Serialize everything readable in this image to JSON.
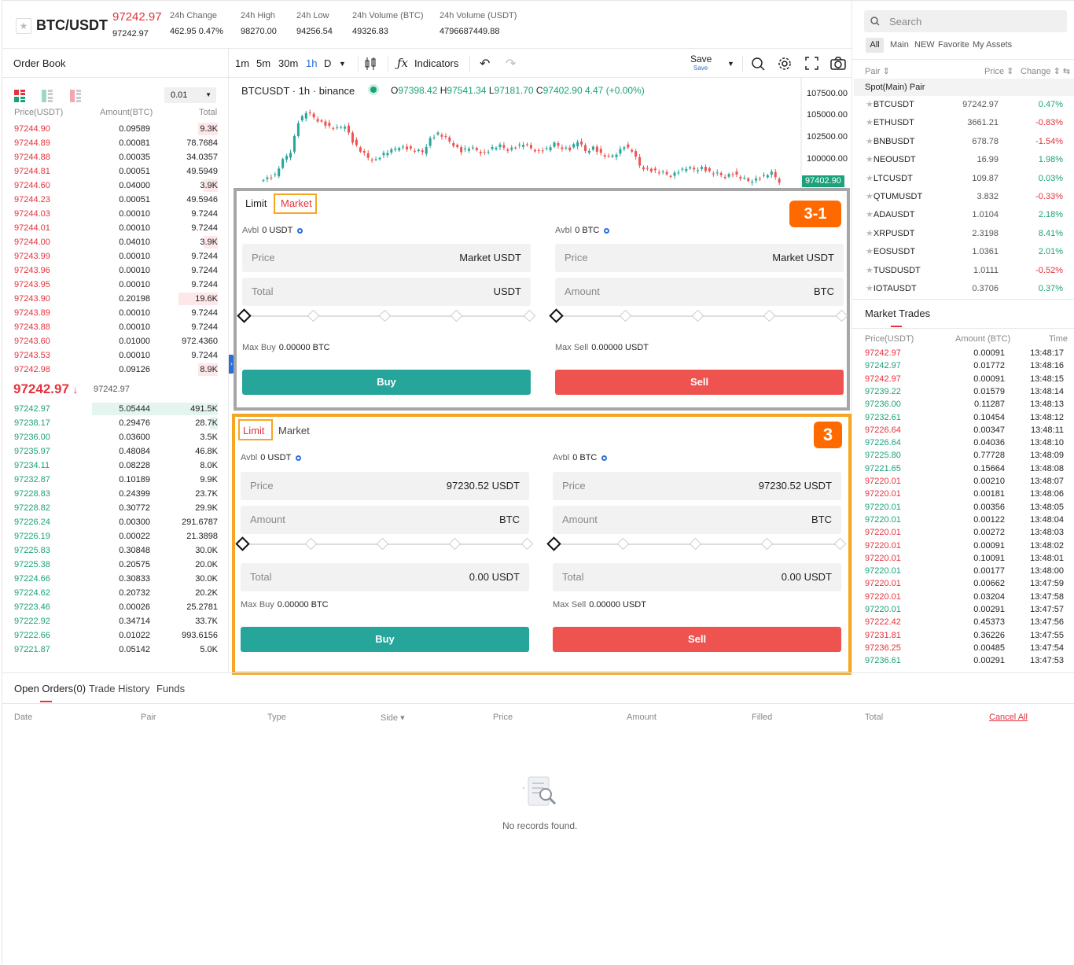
{
  "header": {
    "pair": "BTC/USDT",
    "last_price": "97242.97",
    "last_price_sub": "97242.97",
    "stats": [
      {
        "label": "24h Change",
        "value": "462.95 0.47%"
      },
      {
        "label": "24h High",
        "value": "98270.00"
      },
      {
        "label": "24h Low",
        "value": "94256.54"
      },
      {
        "label": "24h Volume (BTC)",
        "value": "49326.83"
      },
      {
        "label": "24h Volume (USDT)",
        "value": "4796687449.88"
      }
    ]
  },
  "order_book": {
    "title": "Order Book",
    "precision": "0.01",
    "cols": [
      "Price(USDT)",
      "Amount(BTC)",
      "Total"
    ],
    "asks": [
      [
        "97244.90",
        "0.09589",
        "9.3K"
      ],
      [
        "97244.89",
        "0.00081",
        "78.7684"
      ],
      [
        "97244.88",
        "0.00035",
        "34.0357"
      ],
      [
        "97244.81",
        "0.00051",
        "49.5949"
      ],
      [
        "97244.60",
        "0.04000",
        "3.9K"
      ],
      [
        "97244.23",
        "0.00051",
        "49.5946"
      ],
      [
        "97244.03",
        "0.00010",
        "9.7244"
      ],
      [
        "97244.01",
        "0.00010",
        "9.7244"
      ],
      [
        "97244.00",
        "0.04010",
        "3.9K"
      ],
      [
        "97243.99",
        "0.00010",
        "9.7244"
      ],
      [
        "97243.96",
        "0.00010",
        "9.7244"
      ],
      [
        "97243.95",
        "0.00010",
        "9.7244"
      ],
      [
        "97243.90",
        "0.20198",
        "19.6K"
      ],
      [
        "97243.89",
        "0.00010",
        "9.7244"
      ],
      [
        "97243.88",
        "0.00010",
        "9.7244"
      ],
      [
        "97243.60",
        "0.01000",
        "972.4360"
      ],
      [
        "97243.53",
        "0.00010",
        "9.7244"
      ],
      [
        "97242.98",
        "0.09126",
        "8.9K"
      ]
    ],
    "mid_price": "97242.97",
    "mid_arrow": "↓",
    "mid_sub": "97242.97",
    "bids": [
      [
        "97242.97",
        "5.05444",
        "491.5K"
      ],
      [
        "97238.17",
        "0.29476",
        "28.7K"
      ],
      [
        "97236.00",
        "0.03600",
        "3.5K"
      ],
      [
        "97235.97",
        "0.48084",
        "46.8K"
      ],
      [
        "97234.11",
        "0.08228",
        "8.0K"
      ],
      [
        "97232.87",
        "0.10189",
        "9.9K"
      ],
      [
        "97228.83",
        "0.24399",
        "23.7K"
      ],
      [
        "97228.82",
        "0.30772",
        "29.9K"
      ],
      [
        "97226.24",
        "0.00300",
        "291.6787"
      ],
      [
        "97226.19",
        "0.00022",
        "21.3898"
      ],
      [
        "97225.83",
        "0.30848",
        "30.0K"
      ],
      [
        "97225.38",
        "0.20575",
        "20.0K"
      ],
      [
        "97224.66",
        "0.30833",
        "30.0K"
      ],
      [
        "97224.62",
        "0.20732",
        "20.2K"
      ],
      [
        "97223.46",
        "0.00026",
        "25.2781"
      ],
      [
        "97222.92",
        "0.34714",
        "33.7K"
      ],
      [
        "97222.66",
        "0.01022",
        "993.6156"
      ],
      [
        "97221.87",
        "0.05142",
        "5.0K"
      ]
    ],
    "ask_depth": [
      0.05,
      0,
      0,
      0,
      0.02,
      0,
      0,
      0,
      0.02,
      0,
      0,
      0,
      0.1,
      0,
      0,
      0,
      0,
      0.05
    ],
    "bid_depth": [
      1.0,
      0.06,
      0,
      0,
      0,
      0,
      0,
      0,
      0,
      0,
      0,
      0,
      0,
      0,
      0,
      0,
      0,
      0
    ]
  },
  "chart_toolbar": {
    "intervals": [
      "1m",
      "5m",
      "30m",
      "1h",
      "D"
    ],
    "active": "1h",
    "indicators": "Indicators",
    "save": "Save",
    "save_sub": "Save"
  },
  "chart": {
    "symbol": "BTCUSDT · 1h · binance",
    "ohlc": {
      "o_label": "O",
      "o": "97398.42",
      "h_label": "H",
      "h": "97541.34",
      "l_label": "L",
      "l": "97181.70",
      "c_label": "C",
      "c": "97402.90",
      "chg": "4.47 (+0.00%)"
    },
    "y_ticks": [
      "107500.00",
      "105000.00",
      "102500.00",
      "100000.00"
    ],
    "current": "97402.90"
  },
  "market_form": {
    "tab_limit": "Limit",
    "tab_market": "Market",
    "badge": "3-1",
    "buy": {
      "avbl_label": "Avbl",
      "avbl": "0 USDT",
      "price_label": "Price",
      "price": "Market USDT",
      "total_label": "Total",
      "total": "USDT",
      "max_label": "Max Buy",
      "max": "0.00000  BTC",
      "button": "Buy"
    },
    "sell": {
      "avbl_label": "Avbl",
      "avbl": "0 BTC",
      "price_label": "Price",
      "price": "Market USDT",
      "amount_label": "Amount",
      "amount": "BTC",
      "max_label": "Max Sell",
      "max": "0.00000  USDT",
      "button": "Sell"
    }
  },
  "limit_form": {
    "tab_limit": "Limit",
    "tab_market": "Market",
    "badge": "3",
    "buy": {
      "avbl_label": "Avbl",
      "avbl": "0 USDT",
      "price_label": "Price",
      "price": "97230.52 USDT",
      "amount_label": "Amount",
      "amount": "BTC",
      "total_label": "Total",
      "total": "0.00 USDT",
      "max_label": "Max Buy",
      "max": "0.00000  BTC",
      "button": "Buy"
    },
    "sell": {
      "avbl_label": "Avbl",
      "avbl": "0 BTC",
      "price_label": "Price",
      "price": "97230.52 USDT",
      "amount_label": "Amount",
      "amount": "BTC",
      "total_label": "Total",
      "total": "0.00 USDT",
      "max_label": "Max Sell",
      "max": "0.00000  USDT",
      "button": "Sell"
    }
  },
  "orders": {
    "tabs": [
      "Open Orders(0)",
      "Trade History",
      "Funds"
    ],
    "cols": [
      "Date",
      "Pair",
      "Type",
      "Side ▾",
      "Price",
      "Amount",
      "Filled",
      "Total"
    ],
    "cancel_all": "Cancel All",
    "empty": "No records found."
  },
  "search": {
    "placeholder": "Search"
  },
  "pair_tabs": [
    "All",
    "Main",
    "NEW",
    "Favorite",
    "My Assets"
  ],
  "pairs_head": {
    "pair": "Pair ⇕",
    "price": "Price ⇕",
    "change": "Change ⇕ ⇆"
  },
  "pairs_group": "Spot(Main) Pair",
  "pairs": [
    [
      "BTCUSDT",
      "97242.97",
      "0.47%"
    ],
    [
      "ETHUSDT",
      "3661.21",
      "-0.83%"
    ],
    [
      "BNBUSDT",
      "678.78",
      "-1.54%"
    ],
    [
      "NEOUSDT",
      "16.99",
      "1.98%"
    ],
    [
      "LTCUSDT",
      "109.87",
      "0.03%"
    ],
    [
      "QTUMUSDT",
      "3.832",
      "-0.33%"
    ],
    [
      "ADAUSDT",
      "1.0104",
      "2.18%"
    ],
    [
      "XRPUSDT",
      "2.3198",
      "8.41%"
    ],
    [
      "EOSUSDT",
      "1.0361",
      "2.01%"
    ],
    [
      "TUSDUSDT",
      "1.0111",
      "-0.52%"
    ],
    [
      "IOTAUSDT",
      "0.3706",
      "0.37%"
    ]
  ],
  "market_trades": {
    "title": "Market Trades",
    "cols": [
      "Price(USDT)",
      "Amount (BTC)",
      "Time"
    ],
    "rows": [
      [
        "97242.97",
        "0.00091",
        "13:48:17",
        "r"
      ],
      [
        "97242.97",
        "0.01772",
        "13:48:16",
        "g"
      ],
      [
        "97242.97",
        "0.00091",
        "13:48:15",
        "r"
      ],
      [
        "97239.22",
        "0.01579",
        "13:48:14",
        "g"
      ],
      [
        "97236.00",
        "0.11287",
        "13:48:13",
        "g"
      ],
      [
        "97232.61",
        "0.10454",
        "13:48:12",
        "g"
      ],
      [
        "97226.64",
        "0.00347",
        "13:48:11",
        "r"
      ],
      [
        "97226.64",
        "0.04036",
        "13:48:10",
        "g"
      ],
      [
        "97225.80",
        "0.77728",
        "13:48:09",
        "g"
      ],
      [
        "97221.65",
        "0.15664",
        "13:48:08",
        "g"
      ],
      [
        "97220.01",
        "0.00210",
        "13:48:07",
        "r"
      ],
      [
        "97220.01",
        "0.00181",
        "13:48:06",
        "r"
      ],
      [
        "97220.01",
        "0.00356",
        "13:48:05",
        "g"
      ],
      [
        "97220.01",
        "0.00122",
        "13:48:04",
        "g"
      ],
      [
        "97220.01",
        "0.00272",
        "13:48:03",
        "r"
      ],
      [
        "97220.01",
        "0.00091",
        "13:48:02",
        "r"
      ],
      [
        "97220.01",
        "0.10091",
        "13:48:01",
        "r"
      ],
      [
        "97220.01",
        "0.00177",
        "13:48:00",
        "g"
      ],
      [
        "97220.01",
        "0.00662",
        "13:47:59",
        "r"
      ],
      [
        "97220.01",
        "0.03204",
        "13:47:58",
        "r"
      ],
      [
        "97220.01",
        "0.00291",
        "13:47:57",
        "g"
      ],
      [
        "97222.42",
        "0.45373",
        "13:47:56",
        "r"
      ],
      [
        "97231.81",
        "0.36226",
        "13:47:55",
        "r"
      ],
      [
        "97236.25",
        "0.00485",
        "13:47:54",
        "r"
      ],
      [
        "97236.61",
        "0.00291",
        "13:47:53",
        "g"
      ]
    ]
  },
  "colors": {
    "red": "#e5333d",
    "green": "#1ba27a",
    "buy": "#26a69a",
    "sell": "#ef5350",
    "highlight_orange": "#f5a623",
    "badge": "#ff6a00"
  }
}
